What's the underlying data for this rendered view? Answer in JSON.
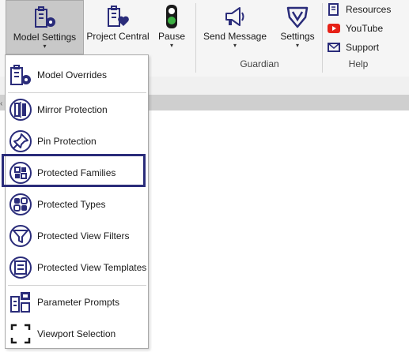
{
  "ribbon": {
    "buttons": [
      {
        "label": "Model Settings",
        "icon": "model-settings-icon",
        "has_dropdown": true,
        "active": true
      },
      {
        "label": "Project Central",
        "icon": "project-central-icon",
        "has_dropdown": false
      },
      {
        "label": "Pause",
        "icon": "traffic-light-icon",
        "has_dropdown": true
      },
      {
        "label": "Send Message",
        "icon": "megaphone-icon",
        "has_dropdown": true
      },
      {
        "label": "Settings",
        "icon": "guardian-shield-icon",
        "has_dropdown": true
      }
    ],
    "groups": {
      "guardian": "Guardian",
      "help": "Help"
    },
    "help_items": [
      {
        "label": "Resources",
        "icon": "book-icon"
      },
      {
        "label": "YouTube",
        "icon": "youtube-icon"
      },
      {
        "label": "Support",
        "icon": "mail-icon"
      }
    ],
    "dropdown_glyph": "▾"
  },
  "left_marker": "‹",
  "menu": {
    "items": [
      {
        "label": "Model Overrides",
        "icon": "model-overrides-icon"
      },
      {
        "label": "Mirror Protection",
        "icon": "mirror-protection-icon"
      },
      {
        "label": "Pin Protection",
        "icon": "pin-protection-icon"
      },
      {
        "label": "Protected Families",
        "icon": "protected-families-icon",
        "highlighted": true
      },
      {
        "label": "Protected Types",
        "icon": "protected-types-icon"
      },
      {
        "label": "Protected View Filters",
        "icon": "protected-view-filters-icon"
      },
      {
        "label": "Protected View Templates",
        "icon": "protected-view-templates-icon"
      },
      {
        "label": "Parameter Prompts",
        "icon": "parameter-prompts-icon"
      },
      {
        "label": "Viewport Selection",
        "icon": "viewport-selection-icon"
      }
    ]
  },
  "colors": {
    "icon_navy": "#2a2c7a",
    "highlight_border": "#2a2c7a",
    "youtube_red": "#e62117",
    "traffic_green": "#3cb043",
    "ribbon_bg": "#f5f5f5"
  }
}
